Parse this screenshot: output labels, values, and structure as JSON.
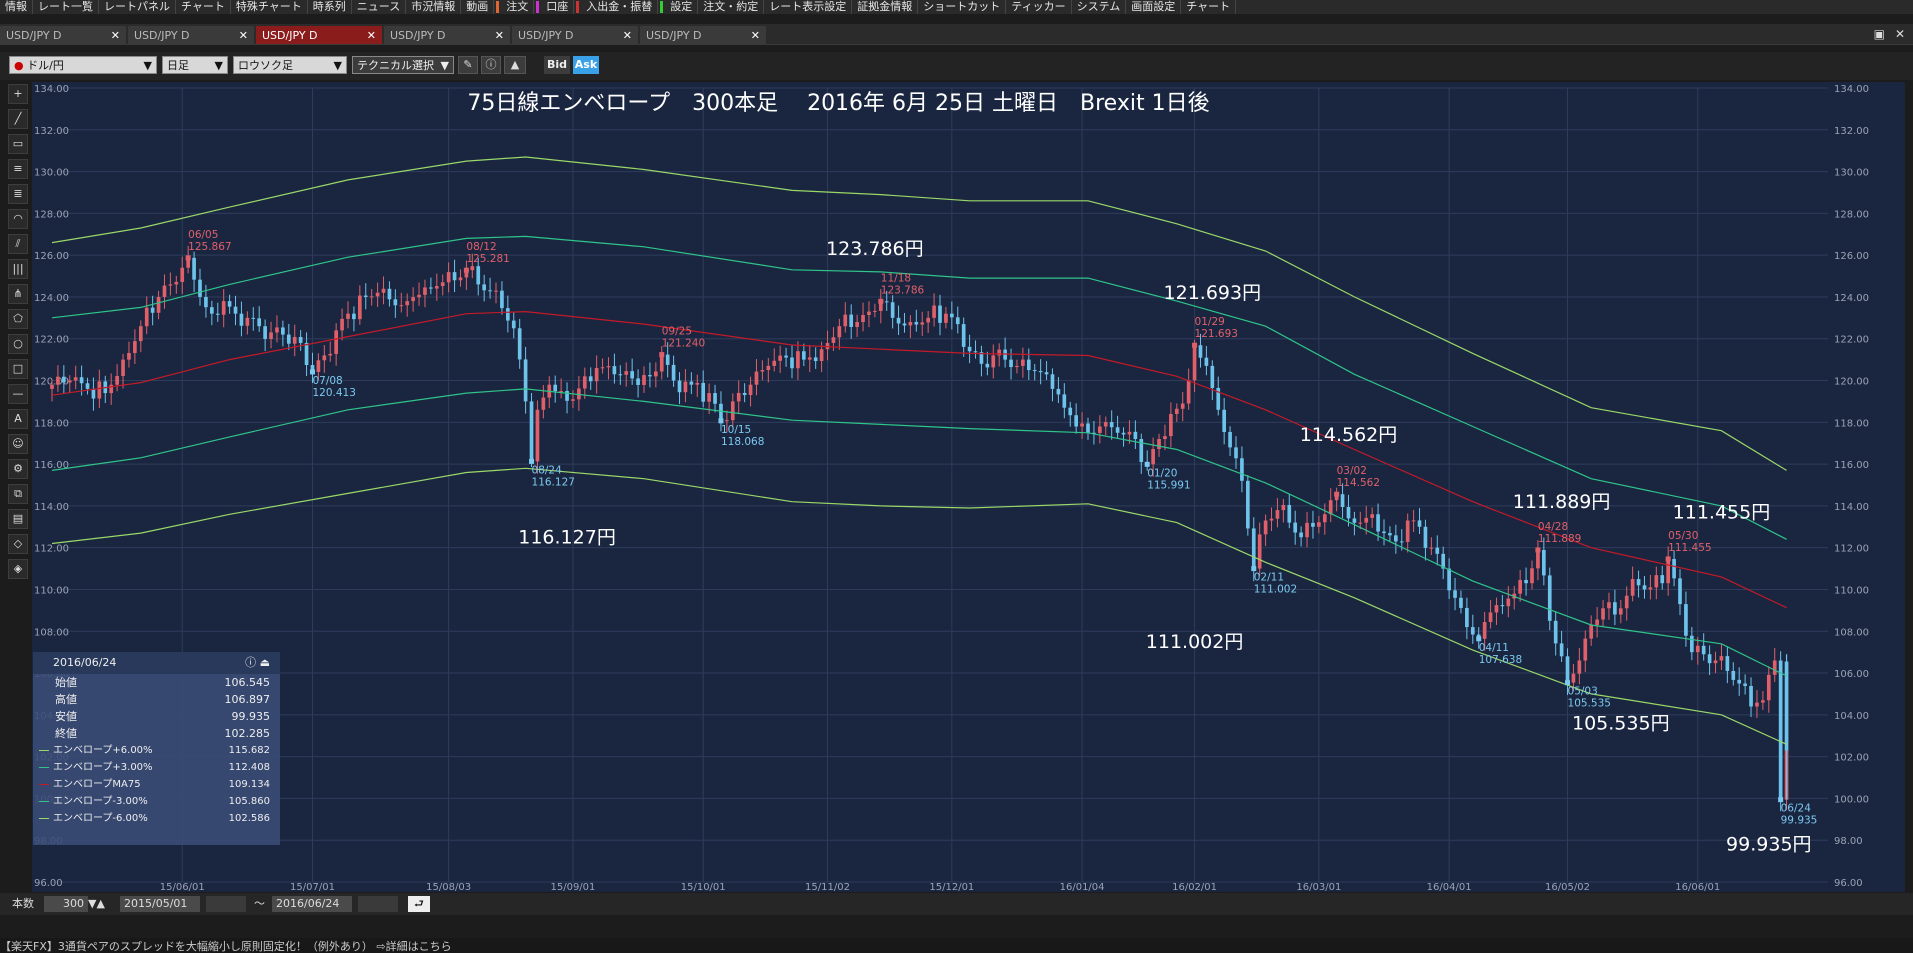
{
  "menu": [
    "情報",
    "レート一覧",
    "レートパネル",
    "チャート",
    "特殊チャート",
    "時系列",
    "ニュース",
    "市況情報",
    "動画",
    "注文",
    "口座",
    "入出金・振替",
    "設定",
    "注文・約定",
    "レート表示設定",
    "証拠金情報",
    "ショートカット",
    "ティッカー",
    "システム",
    "画面設定",
    "チャート"
  ],
  "tabs": [
    {
      "label": "USD/JPY D",
      "active": false
    },
    {
      "label": "USD/JPY D",
      "active": false
    },
    {
      "label": "USD/JPY D",
      "active": true
    },
    {
      "label": "USD/JPY D",
      "active": false
    },
    {
      "label": "USD/JPY D",
      "active": false
    },
    {
      "label": "USD/JPY D",
      "active": false
    }
  ],
  "toolbar": {
    "pair": "ドル/円",
    "period": "日足",
    "style": "ロウソク足",
    "technical": "テクニカル選択",
    "bid": "Bid",
    "ask": "Ask"
  },
  "chart_data": {
    "type": "candlestick",
    "title": "75日線エンベロープ　300本足　 2016年 6月 25日 土曜日　Brexit 1日後",
    "ylim": [
      96,
      134
    ],
    "yticks": [
      "134.00",
      "132.00",
      "130.00",
      "128.00",
      "126.00",
      "124.00",
      "122.00",
      "120.00",
      "118.00",
      "116.00",
      "114.00",
      "112.00",
      "110.00",
      "108.00",
      "106.00",
      "104.00",
      "102.00",
      "100.00",
      "98.00",
      "96.00"
    ],
    "x_index_range": [
      0,
      300
    ],
    "xticks": [
      {
        "label": "15/06/01",
        "i": 22
      },
      {
        "label": "15/07/01",
        "i": 44
      },
      {
        "label": "15/08/03",
        "i": 67
      },
      {
        "label": "15/09/01",
        "i": 88
      },
      {
        "label": "15/10/01",
        "i": 110
      },
      {
        "label": "15/11/02",
        "i": 131
      },
      {
        "label": "15/12/01",
        "i": 152
      },
      {
        "label": "16/01/04",
        "i": 174
      },
      {
        "label": "16/02/01",
        "i": 193
      },
      {
        "label": "16/03/01",
        "i": 214
      },
      {
        "label": "16/04/01",
        "i": 236
      },
      {
        "label": "16/05/02",
        "i": 256
      },
      {
        "label": "16/06/01",
        "i": 278
      }
    ],
    "close_path": [
      [
        0,
        119.8
      ],
      [
        3,
        120.0
      ],
      [
        6,
        119.6
      ],
      [
        9,
        119.4
      ],
      [
        12,
        121.0
      ],
      [
        15,
        122.6
      ],
      [
        18,
        124.0
      ],
      [
        20,
        124.6
      ],
      [
        22,
        125.4
      ],
      [
        23,
        125.87
      ],
      [
        25,
        124.0
      ],
      [
        27,
        123.2
      ],
      [
        29,
        123.8
      ],
      [
        31,
        123.2
      ],
      [
        33,
        123.0
      ],
      [
        35,
        122.6
      ],
      [
        37,
        122.3
      ],
      [
        39,
        122.2
      ],
      [
        42,
        121.8
      ],
      [
        44,
        120.41
      ],
      [
        46,
        121.2
      ],
      [
        48,
        122.4
      ],
      [
        50,
        123.2
      ],
      [
        53,
        124.0
      ],
      [
        55,
        124.2
      ],
      [
        58,
        123.6
      ],
      [
        60,
        123.8
      ],
      [
        62,
        124.1
      ],
      [
        64,
        124.4
      ],
      [
        66,
        124.7
      ],
      [
        68,
        124.8
      ],
      [
        70,
        125.28
      ],
      [
        72,
        124.6
      ],
      [
        75,
        124.3
      ],
      [
        78,
        122.5
      ],
      [
        80,
        119.0
      ],
      [
        81,
        116.13
      ],
      [
        82,
        118.6
      ],
      [
        84,
        119.8
      ],
      [
        86,
        119.5
      ],
      [
        88,
        119.1
      ],
      [
        90,
        120.2
      ],
      [
        92,
        120.6
      ],
      [
        95,
        120.3
      ],
      [
        98,
        120.1
      ],
      [
        101,
        120.2
      ],
      [
        103,
        121.24
      ],
      [
        105,
        120.0
      ],
      [
        108,
        119.8
      ],
      [
        111,
        119.4
      ],
      [
        113,
        118.07
      ],
      [
        115,
        119.0
      ],
      [
        118,
        119.8
      ],
      [
        121,
        120.7
      ],
      [
        124,
        121.1
      ],
      [
        127,
        121.0
      ],
      [
        130,
        121.5
      ],
      [
        133,
        122.6
      ],
      [
        136,
        122.8
      ],
      [
        138,
        123.3
      ],
      [
        140,
        123.79
      ],
      [
        142,
        123.0
      ],
      [
        145,
        122.8
      ],
      [
        148,
        123.0
      ],
      [
        151,
        123.2
      ],
      [
        153,
        122.7
      ],
      [
        155,
        121.4
      ],
      [
        157,
        120.8
      ],
      [
        159,
        121.2
      ],
      [
        161,
        121.0
      ],
      [
        163,
        120.7
      ],
      [
        165,
        120.5
      ],
      [
        167,
        120.4
      ],
      [
        169,
        119.6
      ],
      [
        171,
        118.7
      ],
      [
        173,
        117.8
      ],
      [
        175,
        117.5
      ],
      [
        177,
        117.8
      ],
      [
        180,
        117.5
      ],
      [
        183,
        117.2
      ],
      [
        185,
        115.99
      ],
      [
        187,
        117.2
      ],
      [
        189,
        118.4
      ],
      [
        191,
        118.9
      ],
      [
        193,
        121.69
      ],
      [
        195,
        120.7
      ],
      [
        197,
        118.6
      ],
      [
        199,
        116.8
      ],
      [
        201,
        115.2
      ],
      [
        203,
        111.0
      ],
      [
        205,
        113.3
      ],
      [
        207,
        113.8
      ],
      [
        209,
        113.2
      ],
      [
        211,
        112.5
      ],
      [
        213,
        113.0
      ],
      [
        215,
        113.6
      ],
      [
        217,
        114.56
      ],
      [
        219,
        113.4
      ],
      [
        221,
        113.2
      ],
      [
        223,
        113.6
      ],
      [
        225,
        112.7
      ],
      [
        227,
        112.3
      ],
      [
        229,
        113.3
      ],
      [
        231,
        113.0
      ],
      [
        233,
        112.0
      ],
      [
        235,
        111.0
      ],
      [
        237,
        109.6
      ],
      [
        239,
        108.2
      ],
      [
        241,
        107.64
      ],
      [
        243,
        108.9
      ],
      [
        245,
        109.2
      ],
      [
        247,
        109.8
      ],
      [
        249,
        110.3
      ],
      [
        251,
        111.89
      ],
      [
        253,
        108.5
      ],
      [
        255,
        106.8
      ],
      [
        256,
        105.54
      ],
      [
        258,
        106.6
      ],
      [
        260,
        108.3
      ],
      [
        262,
        109.1
      ],
      [
        264,
        108.8
      ],
      [
        266,
        109.7
      ],
      [
        268,
        110.2
      ],
      [
        270,
        110.1
      ],
      [
        272,
        110.3
      ],
      [
        273,
        111.46
      ],
      [
        275,
        109.3
      ],
      [
        277,
        107.0
      ],
      [
        279,
        106.9
      ],
      [
        281,
        106.6
      ],
      [
        283,
        106.1
      ],
      [
        285,
        105.5
      ],
      [
        287,
        104.4
      ],
      [
        289,
        104.7
      ],
      [
        291,
        106.6
      ],
      [
        292,
        99.94
      ],
      [
        293,
        102.29
      ]
    ],
    "series": [
      {
        "name": "エンベロープ+6.00%",
        "color": "#9ad868",
        "points": [
          [
            0,
            126.6
          ],
          [
            15,
            127.3
          ],
          [
            30,
            128.3
          ],
          [
            50,
            129.6
          ],
          [
            70,
            130.5
          ],
          [
            80,
            130.7
          ],
          [
            100,
            130.1
          ],
          [
            125,
            129.1
          ],
          [
            140,
            128.9
          ],
          [
            155,
            128.6
          ],
          [
            175,
            128.6
          ],
          [
            190,
            127.5
          ],
          [
            205,
            126.2
          ],
          [
            220,
            124.0
          ],
          [
            240,
            121.3
          ],
          [
            260,
            118.7
          ],
          [
            282,
            117.6
          ],
          [
            293,
            115.7
          ]
        ]
      },
      {
        "name": "エンベロープ+3.00%",
        "color": "#2fc48a",
        "points": [
          [
            0,
            123.0
          ],
          [
            15,
            123.5
          ],
          [
            30,
            124.6
          ],
          [
            50,
            125.9
          ],
          [
            70,
            126.8
          ],
          [
            80,
            126.9
          ],
          [
            100,
            126.4
          ],
          [
            125,
            125.3
          ],
          [
            140,
            125.2
          ],
          [
            155,
            124.9
          ],
          [
            175,
            124.9
          ],
          [
            190,
            123.8
          ],
          [
            205,
            122.6
          ],
          [
            220,
            120.3
          ],
          [
            240,
            117.8
          ],
          [
            260,
            115.3
          ],
          [
            282,
            114.0
          ],
          [
            293,
            112.4
          ]
        ]
      },
      {
        "name": "エンベロープMA75",
        "color": "#c41a28",
        "points": [
          [
            0,
            119.3
          ],
          [
            15,
            119.9
          ],
          [
            30,
            121.0
          ],
          [
            50,
            122.1
          ],
          [
            70,
            123.2
          ],
          [
            80,
            123.3
          ],
          [
            100,
            122.7
          ],
          [
            125,
            121.7
          ],
          [
            140,
            121.5
          ],
          [
            155,
            121.3
          ],
          [
            175,
            121.2
          ],
          [
            190,
            120.2
          ],
          [
            205,
            118.6
          ],
          [
            220,
            116.7
          ],
          [
            240,
            114.2
          ],
          [
            260,
            112.0
          ],
          [
            282,
            110.6
          ],
          [
            293,
            109.13
          ]
        ]
      },
      {
        "name": "エンベロープ-3.00%",
        "color": "#2fc48a",
        "points": [
          [
            0,
            115.7
          ],
          [
            15,
            116.3
          ],
          [
            30,
            117.3
          ],
          [
            50,
            118.6
          ],
          [
            70,
            119.4
          ],
          [
            80,
            119.6
          ],
          [
            100,
            119.0
          ],
          [
            125,
            118.1
          ],
          [
            140,
            117.9
          ],
          [
            155,
            117.7
          ],
          [
            175,
            117.5
          ],
          [
            190,
            116.7
          ],
          [
            205,
            115.1
          ],
          [
            220,
            113.1
          ],
          [
            240,
            110.4
          ],
          [
            260,
            108.3
          ],
          [
            282,
            107.4
          ],
          [
            293,
            105.86
          ]
        ]
      },
      {
        "name": "エンベロープ-6.00%",
        "color": "#9ad868",
        "points": [
          [
            0,
            112.2
          ],
          [
            15,
            112.7
          ],
          [
            30,
            113.6
          ],
          [
            50,
            114.6
          ],
          [
            70,
            115.6
          ],
          [
            80,
            115.8
          ],
          [
            100,
            115.3
          ],
          [
            125,
            114.2
          ],
          [
            140,
            114.0
          ],
          [
            155,
            113.9
          ],
          [
            175,
            114.1
          ],
          [
            190,
            113.2
          ],
          [
            205,
            111.3
          ],
          [
            220,
            109.6
          ],
          [
            240,
            107.1
          ],
          [
            260,
            105.0
          ],
          [
            282,
            104.0
          ],
          [
            293,
            102.59
          ]
        ]
      }
    ],
    "markers": [
      {
        "i": 23,
        "date": "06/05",
        "value": "125.867",
        "kind": "high",
        "v": 125.87
      },
      {
        "i": 44,
        "date": "07/08",
        "value": "120.413",
        "kind": "low",
        "v": 120.41
      },
      {
        "i": 70,
        "date": "08/12",
        "value": "125.281",
        "kind": "high",
        "v": 125.28
      },
      {
        "i": 81,
        "date": "08/24",
        "value": "116.127",
        "kind": "low",
        "v": 116.13
      },
      {
        "i": 103,
        "date": "09/25",
        "value": "121.240",
        "kind": "high",
        "v": 121.24
      },
      {
        "i": 113,
        "date": "10/15",
        "value": "118.068",
        "kind": "low",
        "v": 118.07
      },
      {
        "i": 140,
        "date": "11/18",
        "value": "123.786",
        "kind": "high",
        "v": 123.79
      },
      {
        "i": 185,
        "date": "01/20",
        "value": "115.991",
        "kind": "low",
        "v": 115.99
      },
      {
        "i": 193,
        "date": "01/29",
        "value": "121.693",
        "kind": "high",
        "v": 121.69
      },
      {
        "i": 203,
        "date": "02/11",
        "value": "111.002",
        "kind": "low",
        "v": 111.0
      },
      {
        "i": 217,
        "date": "03/02",
        "value": "114.562",
        "kind": "high",
        "v": 114.56
      },
      {
        "i": 241,
        "date": "04/11",
        "value": "107.638",
        "kind": "low",
        "v": 107.64
      },
      {
        "i": 251,
        "date": "04/28",
        "value": "111.889",
        "kind": "high",
        "v": 111.89
      },
      {
        "i": 256,
        "date": "05/03",
        "value": "105.535",
        "kind": "low",
        "v": 105.54
      },
      {
        "i": 273,
        "date": "05/30",
        "value": "111.455",
        "kind": "high",
        "v": 111.46
      },
      {
        "i": 292,
        "date": "06/24",
        "value": "99.935",
        "kind": "low",
        "v": 99.94
      }
    ],
    "callouts": [
      {
        "text": "123.786円",
        "i": 139,
        "v": 126.0
      },
      {
        "text": "121.693円",
        "i": 196,
        "v": 123.9
      },
      {
        "text": "114.562円",
        "i": 219,
        "v": 117.1
      },
      {
        "text": "111.889円",
        "i": 255,
        "v": 113.9
      },
      {
        "text": "111.455円",
        "i": 282,
        "v": 113.4
      },
      {
        "text": "116.127円",
        "i": 87,
        "v": 112.2
      },
      {
        "text": "111.002円",
        "i": 193,
        "v": 107.2
      },
      {
        "text": "105.535円",
        "i": 265,
        "v": 103.3
      },
      {
        "text": "99.935円",
        "i": 290,
        "v": 97.5
      }
    ]
  },
  "ohlc_panel": {
    "date": "2016/06/24",
    "rows": [
      {
        "k": "始値",
        "v": "106.545"
      },
      {
        "k": "高値",
        "v": "106.897"
      },
      {
        "k": "安値",
        "v": "99.935"
      },
      {
        "k": "終値",
        "v": "102.285"
      }
    ],
    "envelopes": [
      {
        "k": "エンベロープ+6.00%",
        "v": "115.682",
        "color": "#9ad868"
      },
      {
        "k": "エンベロープ+3.00%",
        "v": "112.408",
        "color": "#2fc48a"
      },
      {
        "k": "エンベロープMA75",
        "v": "109.134",
        "color": "#c41a28"
      },
      {
        "k": "エンベロープ-3.00%",
        "v": "105.860",
        "color": "#2fc48a"
      },
      {
        "k": "エンベロープ-6.00%",
        "v": "102.586",
        "color": "#9ad868"
      }
    ]
  },
  "bottom": {
    "bars_label": "本数",
    "bars_value": "300",
    "from_date": "2015/05/01",
    "tilde": "～",
    "to_date": "2016/06/24"
  },
  "ticker": "【楽天FX】3通貨ペアのスプレッドを大幅縮小し原則固定化！（例外あり） ⇨詳細はこちら",
  "colors": {
    "bg": "#1a2640",
    "up": "#e0606a",
    "down": "#6ec3ea",
    "grid": "#2e3c5c",
    "label_high": "#e0606a",
    "label_low": "#7cc8ef"
  }
}
